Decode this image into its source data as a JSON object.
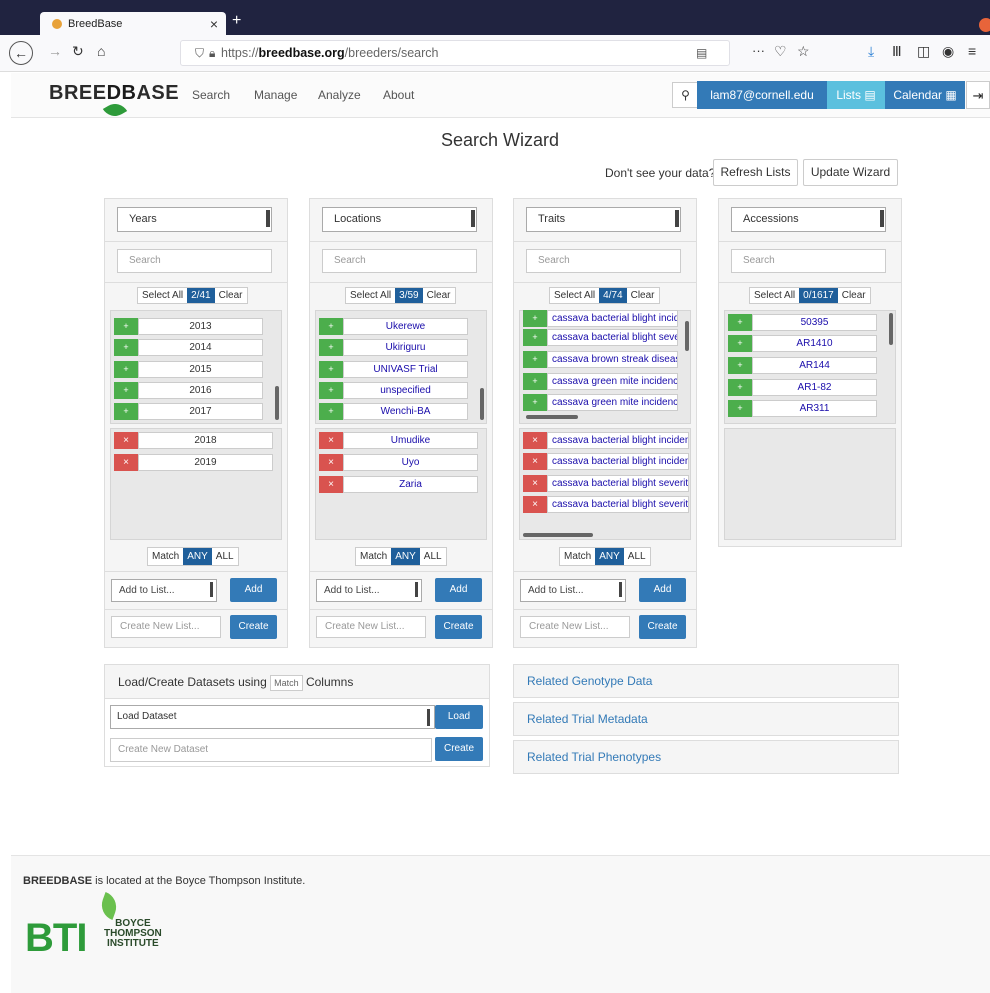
{
  "browser": {
    "tab_title": "BreedBase",
    "tab_close": "×",
    "new_tab": "+",
    "url_prefix": "https://",
    "url_host": "breedbase.org",
    "url_path": "/breeders/search",
    "more": "···"
  },
  "header": {
    "logo_pre": "BREE",
    "logo_db": "DB",
    "logo_post": "ASE",
    "menu": [
      "Search",
      "Manage",
      "Analyze",
      "About"
    ],
    "user": "lam87@cornell.edu",
    "lists": "Lists ▤",
    "calendar": "Calendar ▦"
  },
  "main": {
    "title": "Search Wizard",
    "dont_see": "Don't see your data?",
    "refresh": "Refresh Lists",
    "update": "Update Wizard"
  },
  "common": {
    "search_placeholder": "Search",
    "select_all": "Select All",
    "clear": "Clear",
    "match": "Match",
    "any": "ANY",
    "all": "ALL",
    "add_to_list": "Add to List...",
    "add": "Add",
    "create_new_list": "Create New List...",
    "create": "Create",
    "plus": "+",
    "minus": "×"
  },
  "panels": [
    {
      "select": "Years",
      "count": "2/41",
      "available": [
        "2013",
        "2014",
        "2015",
        "2016",
        "2017"
      ],
      "selected": [
        "2018",
        "2019"
      ]
    },
    {
      "select": "Locations",
      "count": "3/59",
      "available": [
        "Ukerewe",
        "Ukiriguru",
        "UNIVASF Trial",
        "unspecified",
        "Wenchi-BA"
      ],
      "selected": [
        "Umudike",
        "Uyo",
        "Zaria"
      ]
    },
    {
      "select": "Traits",
      "count": "4/74",
      "available": [
        "cassava bacterial blight incide",
        "cassava bacterial blight sever",
        "cassava brown streak disease",
        "cassava green mite incidence",
        "cassava green mite incidence"
      ],
      "selected": [
        "cassava bacterial blight inciden",
        "cassava bacterial blight inciden",
        "cassava bacterial blight severity",
        "cassava bacterial blight severity"
      ]
    },
    {
      "select": "Accessions",
      "count": "0/1617",
      "available": [
        "50395",
        "AR1410",
        "AR144",
        "AR1-82",
        "AR311"
      ],
      "selected": []
    }
  ],
  "datasets": {
    "head_pre": "Load/Create Datasets using",
    "head_match": "Match",
    "head_post": "Columns",
    "load_select": "Load Dataset",
    "load_btn": "Load",
    "create_placeholder": "Create New Dataset",
    "create_btn": "Create"
  },
  "related": [
    "Related Genotype Data",
    "Related Trial Metadata",
    "Related Trial Phenotypes"
  ],
  "footer": {
    "logo_pre": "BREE",
    "logo_db": "DB",
    "logo_post": "ASE",
    "text": " is located at the Boyce Thompson Institute.",
    "bti": "BTI",
    "bti_line1": "BOYCE",
    "bti_line2": "THOMPSON",
    "bti_line3": "INSTITUTE"
  },
  "colors": {
    "primary": "#337ab7",
    "info": "#5bc0de",
    "success": "#4cae4c",
    "danger": "#d9534f",
    "count_badge": "#1f5f9b",
    "bti_green": "#2e9b3a"
  }
}
